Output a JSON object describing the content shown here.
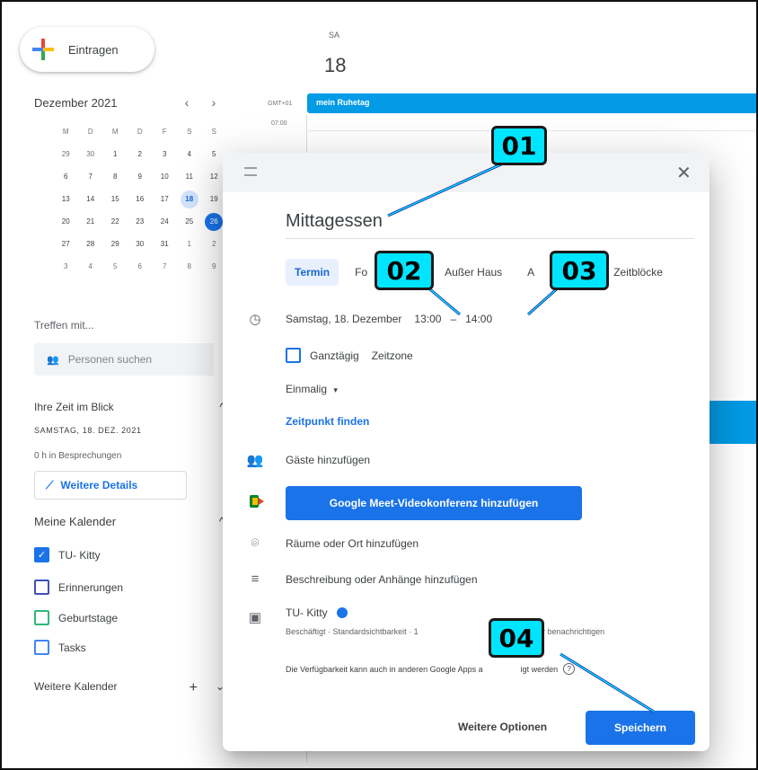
{
  "sidebar": {
    "create_label": "Eintragen",
    "month_title": "Dezember 2021",
    "prev_icon": "‹",
    "next_icon": "›",
    "weekday_heads": [
      "",
      "M",
      "D",
      "M",
      "D",
      "F",
      "S",
      "S"
    ],
    "weeks": [
      [
        "",
        "29",
        "30",
        "1",
        "2",
        "3",
        "4",
        "5"
      ],
      [
        "",
        "6",
        "7",
        "8",
        "9",
        "10",
        "11",
        "12"
      ],
      [
        "",
        "13",
        "14",
        "15",
        "16",
        "17",
        "18",
        "19"
      ],
      [
        "",
        "20",
        "21",
        "22",
        "23",
        "24",
        "25",
        "26"
      ],
      [
        "",
        "27",
        "28",
        "29",
        "30",
        "31",
        "1",
        "2"
      ],
      [
        "",
        "3",
        "4",
        "5",
        "6",
        "7",
        "8",
        "9"
      ]
    ],
    "meet_with": "Treffen mit...",
    "search_people_placeholder": "Personen suchen",
    "time_glance_title": "Ihre Zeit im Blick",
    "time_glance_date": "SAMSTAG, 18. DEZ. 2021",
    "meetings_hours": "0 h in Besprechungen",
    "more_details_label": "Weitere Details",
    "my_calendars_title": "Meine Kalender",
    "calendars": [
      {
        "label": "TU- Kitty",
        "color": "#1a73e8",
        "checked": true
      },
      {
        "label": "Erinnerungen",
        "color": "#3f51b5",
        "checked": false
      },
      {
        "label": "Geburtstage",
        "color": "#33b679",
        "checked": false
      },
      {
        "label": "Tasks",
        "color": "#4285f4",
        "checked": false
      }
    ],
    "other_calendars_title": "Weitere Kalender",
    "collapse_icon": "^",
    "plus_icon": "+",
    "chevron_icon": "⌄"
  },
  "day_view": {
    "weekday": "SA",
    "day_number": "18",
    "timezone": "GMT+01",
    "hour_label": "07:00",
    "allday_event": "mein Ruhetag"
  },
  "dialog": {
    "close_icon": "✕",
    "title_value": "Mittagessen",
    "tabs": [
      {
        "label": "Termin",
        "active": true
      },
      {
        "label": "Fo",
        "active": false
      },
      {
        "label": "Außer Haus",
        "active": false
      },
      {
        "label": "A",
        "active": false
      },
      {
        "label": "Zeitblöcke",
        "active": false
      }
    ],
    "date_text": "Samstag, 18. Dezember",
    "start_time": "13:00",
    "time_separator": "–",
    "end_time": "14:00",
    "allday_label": "Ganztägig",
    "timezone_label": "Zeitzone",
    "repeat_label": "Einmalig",
    "repeat_caret": "▾",
    "find_time_label": "Zeitpunkt finden",
    "add_guests": "Gäste hinzufügen",
    "meet_button": "Google Meet-Videokonferenz hinzufügen",
    "add_location": "Räume oder Ort hinzufügen",
    "add_description": "Beschreibung oder Anhänge hinzufügen",
    "calendar_owner": "TU- Kitty",
    "calendar_sub": "Beschäftigt · Standardsichtbarkeit · 1",
    "calendar_sub_tail": "orher benachrichtigen",
    "availability_note": "Die Verfügbarkeit kann auch in anderen Google Apps a",
    "availability_tail": "igt werden",
    "more_options": "Weitere Optionen",
    "save": "Speichern"
  },
  "callouts": [
    "01",
    "02",
    "03",
    "04"
  ],
  "colors": {
    "accent": "#1a73e8",
    "callout": "#00e5ff",
    "event": "#039be5"
  }
}
